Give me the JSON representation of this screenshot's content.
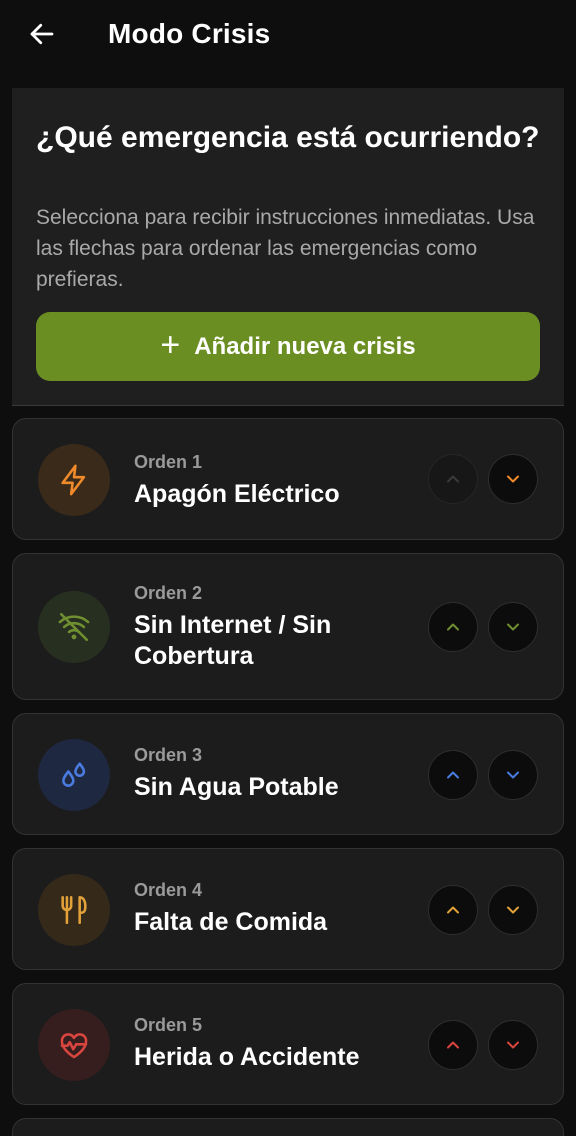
{
  "header": {
    "title": "Modo Crisis"
  },
  "intro": {
    "question": "¿Qué emergencia está ocurriendo?",
    "description": "Selecciona para recibir instrucciones inmediatas. Usa las flechas para ordenar las emergencias como prefieras.",
    "add_button_label": "Añadir nueva crisis",
    "add_button_color": "#6b8e23"
  },
  "crises": [
    {
      "order_label": "Orden 1",
      "name": "Apagón Eléctrico",
      "icon": "lightning-icon",
      "accent": "#f08a2b",
      "icon_bg": "#3a2a19",
      "up_enabled": false,
      "down_enabled": true
    },
    {
      "order_label": "Orden 2",
      "name": "Sin Internet / Sin Cobertura",
      "icon": "wifi-off-icon",
      "accent": "#6f8f30",
      "icon_bg": "#273020",
      "up_enabled": true,
      "down_enabled": true
    },
    {
      "order_label": "Orden 3",
      "name": "Sin Agua Potable",
      "icon": "water-drops-icon",
      "accent": "#4a7be0",
      "icon_bg": "#1e2840",
      "up_enabled": true,
      "down_enabled": true
    },
    {
      "order_label": "Orden 4",
      "name": "Falta de Comida",
      "icon": "utensils-icon",
      "accent": "#e3a13a",
      "icon_bg": "#35291a",
      "up_enabled": true,
      "down_enabled": true
    },
    {
      "order_label": "Orden 5",
      "name": "Herida o Accidente",
      "icon": "heart-pulse-icon",
      "accent": "#d9453f",
      "icon_bg": "#361e1e",
      "up_enabled": true,
      "down_enabled": true
    }
  ]
}
